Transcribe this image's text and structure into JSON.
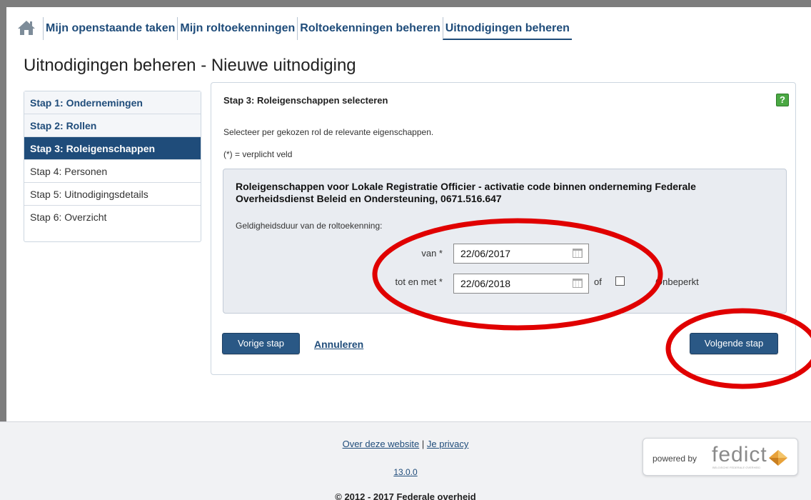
{
  "nav": {
    "home_icon": "home-icon",
    "tabs": [
      {
        "label": "Mijn openstaande taken"
      },
      {
        "label": "Mijn roltoekenningen"
      },
      {
        "label": "Roltoekenningen beheren"
      },
      {
        "label": "Uitnodigingen beheren",
        "active": true
      }
    ]
  },
  "page": {
    "title": "Uitnodigingen beheren - Nieuwe uitnodiging"
  },
  "steps": [
    {
      "label": "Stap 1: Ondernemingen",
      "state": "done"
    },
    {
      "label": "Stap 2: Rollen",
      "state": "done"
    },
    {
      "label": "Stap 3: Roleigenschappen",
      "state": "current"
    },
    {
      "label": "Stap 4: Personen",
      "state": "todo"
    },
    {
      "label": "Stap 5: Uitnodigingsdetails",
      "state": "todo"
    },
    {
      "label": "Stap 6: Overzicht",
      "state": "todo"
    }
  ],
  "panel": {
    "title": "Stap 3: Roleigenschappen selecteren",
    "help": "?",
    "intro": "Selecteer per gekozen rol de relevante eigenschappen.",
    "required_note": "(*) = verplicht veld",
    "props_title": "Roleigenschappen voor Lokale Registratie Officier - activatie code binnen onderneming Federale Overheidsdienst Beleid en Ondersteuning, 0671.516.647",
    "validity_label": "Geldigheidsduur van de roltoekenning:",
    "from_label": "van *",
    "from_value": "22/06/2017",
    "to_label": "tot en met *",
    "to_value": "22/06/2018",
    "or_label": "of",
    "unlimited_label": "Onbeperkt",
    "unlimited_checked": false,
    "prev_button": "Vorige stap",
    "cancel_link": "Annuleren",
    "next_button": "Volgende stap"
  },
  "footer": {
    "about_link": "Over deze website",
    "separator": "|",
    "privacy_link": "Je privacy",
    "version": "13.0.0",
    "copyright": "© 2012 - 2017 Federale overheid",
    "powered_by": "powered by",
    "brand": "fedict",
    "brand_tagline": "BELGISCHE FEDERALE OVERHEID"
  },
  "colors": {
    "primary": "#1f4c7a",
    "button": "#2a5885",
    "help": "#4aa843",
    "annotation": "#e00000",
    "brand_logo": "#e8a23a"
  }
}
